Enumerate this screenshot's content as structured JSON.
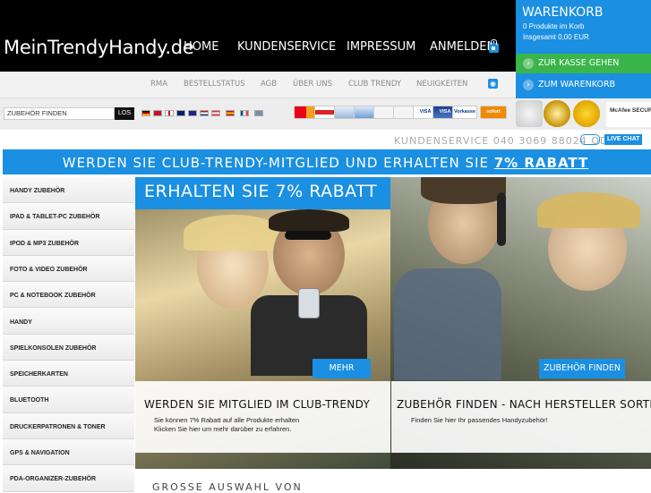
{
  "header": {
    "logo": "MeinTrendyHandy.de",
    "nav": [
      "HOME",
      "KUNDENSERVICE",
      "IMPRESSUM",
      "ANMELDEN"
    ]
  },
  "cart": {
    "title": "WARENKORB",
    "products": "0 Produkte im Korb",
    "total": "Insgesamt 0,00 EUR",
    "checkout_label": "ZUR KASSE GEHEN",
    "cart_label": "ZUM WARENKORB"
  },
  "subnav": [
    "RMA",
    "BESTELLSTATUS",
    "AGB",
    "ÜBER UNS",
    "CLUB TRENDY",
    "NEUIGKEITEN"
  ],
  "search": {
    "value": "ZUBEHÖR FINDEN",
    "button": "LOS"
  },
  "payments": [
    "",
    "",
    "",
    "",
    "",
    "",
    "VISA",
    "VISA",
    "Vorkasse",
    "sofort"
  ],
  "badges": {
    "security": "McAfee SECURE"
  },
  "contact": {
    "text": "KUNDENSERVICE 040 3069 88024 ODER",
    "chat": "LIVE CHAT"
  },
  "banner": {
    "prefix": "WERDEN SIE CLUB-TRENDY-MITGLIED UND ERHALTEN SIE ",
    "strong": "7% RABATT"
  },
  "sidebar": [
    "HANDY ZUBEHÖR",
    "IPAD & TABLET-PC ZUBEHÖR",
    "IPOD & MP3 ZUBEHÖR",
    "FOTO & VIDEO ZUBEHÖR",
    "PC & NOTEBOOK ZUBEHÖR",
    "HANDY",
    "SPIELKONSOLEN ZUBEHÖR",
    "SPEICHERKARTEN",
    "BLUETOOTH",
    "DRUCKERPATRONEN & TONER",
    "GPS & NAVIGATION",
    "PDA-ORGANIZER-ZUBEHÖR"
  ],
  "promo1": {
    "heading": "ERHALTEN SIE 7% RABATT",
    "button": "MEHR",
    "title": "WERDEN SIE MITGLIED IM CLUB-TRENDY",
    "line1": "Sie können 7% Rabatt auf alle Produkte erhalten",
    "line2": "Klicken Sie hier um mehr darüber zu erfahren."
  },
  "promo2": {
    "button": "ZUBEHÖR FINDEN",
    "title": "ZUBEHÖR FINDEN - NACH HERSTELLER SORTIERT",
    "line1": "Finden Sie hier Ihr passendes Handyzubehör!"
  },
  "bottom": {
    "heading": "GROSSE AUSWAHL VON"
  },
  "colors": {
    "accent": "#1b8fe1",
    "cart_green": "#3ab54a",
    "header": "#000000"
  }
}
